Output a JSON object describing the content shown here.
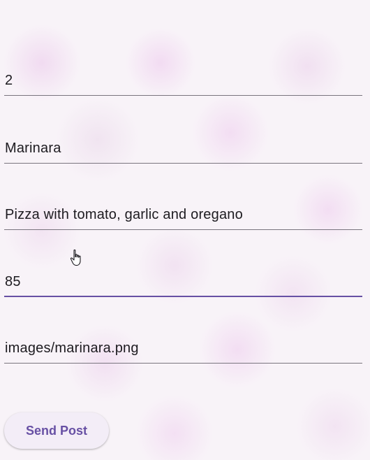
{
  "form": {
    "fields": [
      {
        "value": "2"
      },
      {
        "value": "Marinara"
      },
      {
        "value": "Pizza with tomato, garlic and oregano"
      },
      {
        "value": "85"
      },
      {
        "value": "images/marinara.png"
      }
    ],
    "focused_field_index": 3
  },
  "send_button": {
    "label": "Send Post"
  },
  "colors": {
    "accent": "#6750a4",
    "underline": "#79747e",
    "text": "#1d1b20",
    "button_bg": "#f3edf7"
  },
  "cursor_icon": "hand-pointer-icon"
}
